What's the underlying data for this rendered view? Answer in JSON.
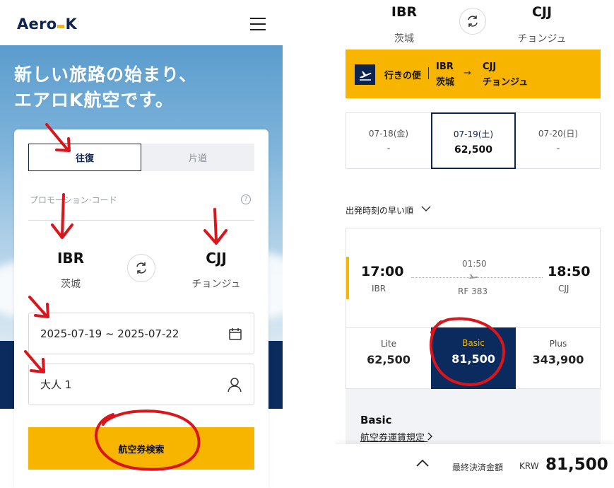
{
  "left": {
    "brand": {
      "part1": "Aero",
      "part2": "K"
    },
    "hero_title_line1": "新しい旅路の始まり、",
    "hero_title_line2": "エアロK航空です。",
    "trip_type": {
      "round": "往復",
      "oneway": "片道",
      "selected": "round"
    },
    "promo": {
      "placeholder": "プロモーション·コード",
      "help": "?"
    },
    "origin": {
      "code": "IBR",
      "city": "茨城"
    },
    "destination": {
      "code": "CJJ",
      "city": "チョンジュ"
    },
    "dates": "2025-07-19 ~ 2025-07-22",
    "passengers": "大人 1",
    "search_label": "航空券検索",
    "colors": {
      "navy": "#0d2350",
      "accent": "#f7b500",
      "annotation": "#d8161c"
    }
  },
  "right": {
    "origin": {
      "code": "IBR",
      "city": "茨城"
    },
    "destination": {
      "code": "CJJ",
      "city": "チョンジュ"
    },
    "outbound": {
      "label": "行きの便",
      "from_code": "IBR",
      "from_city": "茨城",
      "arrow": "→",
      "to_code": "CJJ",
      "to_city": "チョンジュ"
    },
    "dates": [
      {
        "date": "07-18(金)",
        "price": "-"
      },
      {
        "date": "07-19(土)",
        "price": "62,500",
        "selected": true
      },
      {
        "date": "07-20(日)",
        "price": "-"
      }
    ],
    "sort_label": "出発時刻の早い順",
    "flight": {
      "dep_time": "17:00",
      "dep_code": "IBR",
      "duration": "01:50",
      "flight_no": "RF 383",
      "arr_time": "18:50",
      "arr_code": "CJJ"
    },
    "fares": [
      {
        "name": "Lite",
        "price": "62,500"
      },
      {
        "name": "Basic",
        "price": "81,500",
        "selected": true
      },
      {
        "name": "Plus",
        "price": "343,900"
      }
    ],
    "detail": {
      "title": "Basic",
      "link": "航空券運賃規定"
    },
    "footer": {
      "label": "最終決済金額",
      "currency": "KRW",
      "amount": "81,500"
    }
  }
}
